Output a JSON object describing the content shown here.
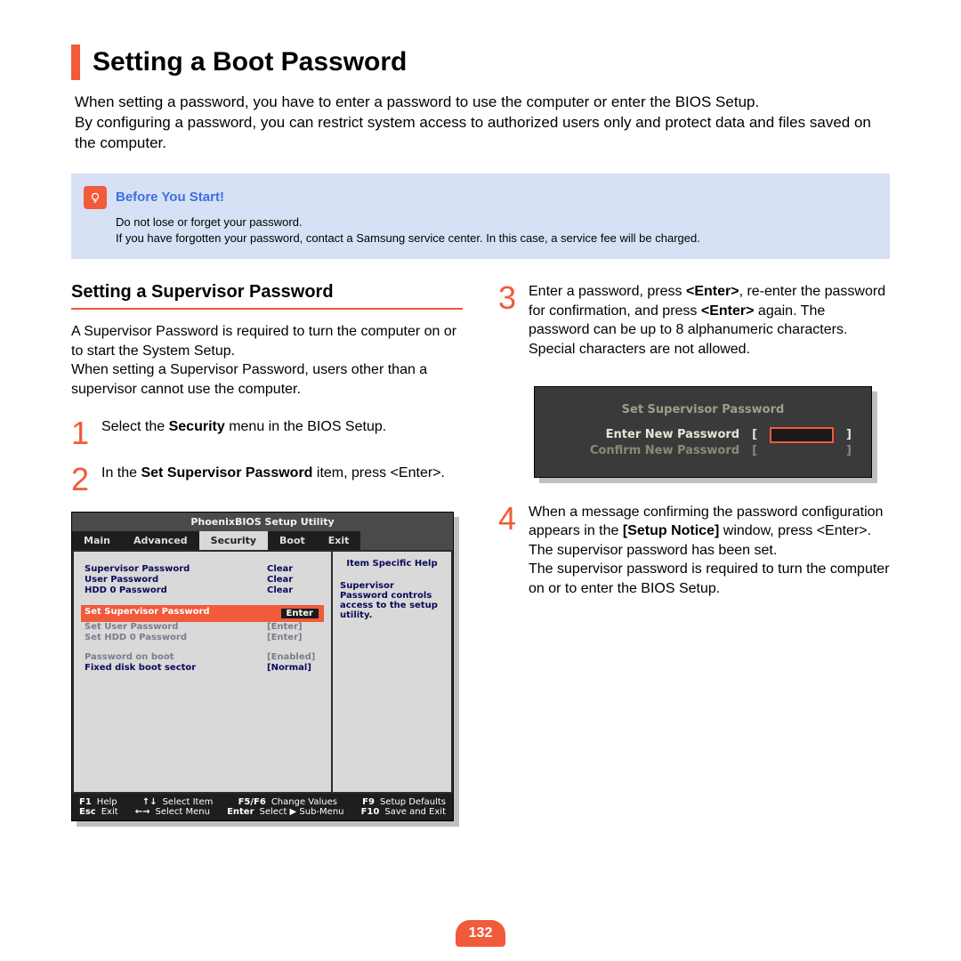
{
  "title": "Setting a Boot Password",
  "intro": "When setting a password, you have to enter a password to use the computer or enter the BIOS Setup.\nBy configuring a password, you can restrict system access to authorized users only and protect data and files saved on the computer.",
  "tip": {
    "title": "Before You Start!",
    "line1": "Do not lose or forget your password.",
    "line2": "If you have forgotten your password, contact a Samsung service center. In this case, a service fee will be charged."
  },
  "left": {
    "subhead": "Setting a Supervisor Password",
    "para": "A Supervisor Password is required to turn the computer on or to start the System Setup.\nWhen setting a Supervisor Password, users other than a supervisor cannot use the computer.",
    "step1_pre": "Select the ",
    "step1_bold": "Security",
    "step1_post": " menu in the BIOS Setup.",
    "step2_pre": "In the ",
    "step2_bold": "Set Supervisor Password",
    "step2_post": " item, press <Enter>."
  },
  "right": {
    "step3_a": "Enter a password, press ",
    "step3_e1": "<Enter>",
    "step3_b": ", re-enter the password for confirmation, and press ",
    "step3_e2": "<Enter>",
    "step3_c": " again. The password can be up to 8 alphanumeric characters. Special characters are not allowed.",
    "step4_a": "When a message confirming the password configuration appears in the ",
    "step4_b": "[Setup Notice]",
    "step4_c": " window, press <Enter>.",
    "step4_d": "The supervisor password has been set.",
    "step4_e": "The supervisor password is required to turn the computer on or to enter the BIOS Setup."
  },
  "bios": {
    "title": "PhoenixBIOS Setup Utility",
    "tabs": [
      "Main",
      "Advanced",
      "Security",
      "Boot",
      "Exit"
    ],
    "active_tab": "Security",
    "rows": [
      {
        "label": "Supervisor Password",
        "value": "Clear"
      },
      {
        "label": "User Password",
        "value": "Clear"
      },
      {
        "label": "HDD 0 Password",
        "value": "Clear"
      }
    ],
    "highlight": {
      "label": "Set Supervisor Password",
      "value": "Enter"
    },
    "rows2": [
      {
        "label": "Set User Password",
        "value": "[Enter]"
      },
      {
        "label": "Set HDD 0 Password",
        "value": "[Enter]"
      }
    ],
    "rows3": [
      {
        "label": "Password on boot",
        "value": "[Enabled]",
        "dim": true
      },
      {
        "label": "Fixed disk boot sector",
        "value": "[Normal]"
      }
    ],
    "help_title": "Item Specific Help",
    "help_text": "Supervisor Password controls access to the setup utility.",
    "footer": [
      [
        "F1",
        "Help",
        "↑↓",
        "Select Item",
        "F5/F6",
        "Change Values",
        "F9",
        "Setup Defaults"
      ],
      [
        "Esc",
        "Exit",
        "←→",
        "Select Menu",
        "Enter",
        "Select ▶ Sub-Menu",
        "F10",
        "Save and Exit"
      ]
    ]
  },
  "dialog": {
    "title": "Set Supervisor Password",
    "row1": "Enter New Password",
    "row2": "Confirm New Password"
  },
  "page": "132"
}
